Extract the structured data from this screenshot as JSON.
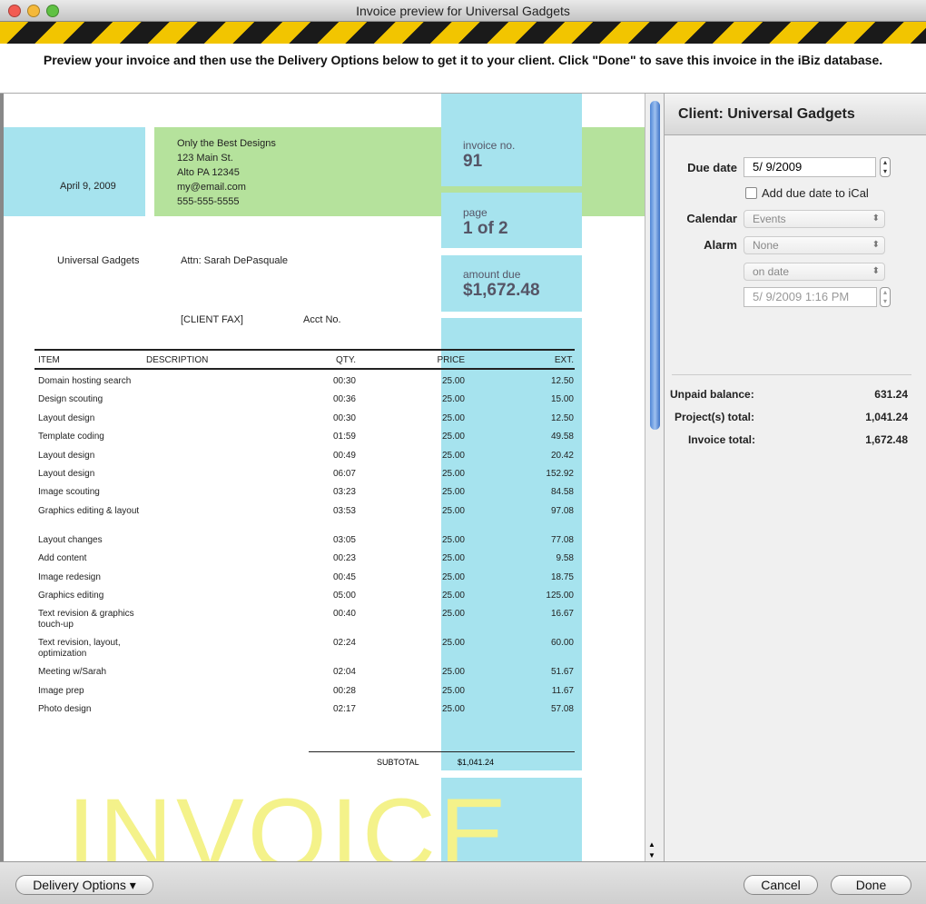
{
  "window": {
    "title": "Invoice preview for Universal Gadgets"
  },
  "instructions": "Preview your invoice and then use the Delivery Options below to get it to your client.  Click \"Done\" to save this invoice in the iBiz database.",
  "invoice": {
    "date": "April 9, 2009",
    "from": [
      "Only the Best Designs",
      "123 Main St.",
      "Alto PA 12345",
      "my@email.com",
      "555-555-5555"
    ],
    "invoice_no_label": "invoice no.",
    "invoice_no": "91",
    "page_label": "page",
    "page": "1 of 2",
    "amount_due_label": "amount due",
    "amount_due": "$1,672.48",
    "client": "Universal Gadgets",
    "attn": "Attn: Sarah DePasquale",
    "client_fax": "[CLIENT FAX]",
    "acct_no": "Acct No.",
    "headers": {
      "item": "ITEM",
      "description": "DESCRIPTION",
      "qty": "QTY.",
      "price": "PRICE",
      "ext": "EXT."
    },
    "rows": [
      {
        "item": "Domain hosting search",
        "qty": "00:30",
        "price": "25.00",
        "ext": "12.50"
      },
      {
        "item": "Design scouting",
        "qty": "00:36",
        "price": "25.00",
        "ext": "15.00"
      },
      {
        "item": "Layout design",
        "qty": "00:30",
        "price": "25.00",
        "ext": "12.50"
      },
      {
        "item": "Template coding",
        "qty": "01:59",
        "price": "25.00",
        "ext": "49.58"
      },
      {
        "item": "Layout design",
        "qty": "00:49",
        "price": "25.00",
        "ext": "20.42"
      },
      {
        "item": "Layout design",
        "qty": "06:07",
        "price": "25.00",
        "ext": "152.92"
      },
      {
        "item": "Image scouting",
        "qty": "03:23",
        "price": "25.00",
        "ext": "84.58"
      },
      {
        "item": "Graphics editing & layout",
        "qty": "03:53",
        "price": "25.00",
        "ext": "97.08"
      },
      {
        "item": "Layout changes",
        "qty": "03:05",
        "price": "25.00",
        "ext": "77.08"
      },
      {
        "item": "Add content",
        "qty": "00:23",
        "price": "25.00",
        "ext": "9.58"
      },
      {
        "item": "Image redesign",
        "qty": "00:45",
        "price": "25.00",
        "ext": "18.75"
      },
      {
        "item": "Graphics editing",
        "qty": "05:00",
        "price": "25.00",
        "ext": "125.00"
      },
      {
        "item": "Text revision & graphics touch-up",
        "qty": "00:40",
        "price": "25.00",
        "ext": "16.67"
      },
      {
        "item": "Text revision, layout, optimization",
        "qty": "02:24",
        "price": "25.00",
        "ext": "60.00"
      },
      {
        "item": "Meeting w/Sarah",
        "qty": "02:04",
        "price": "25.00",
        "ext": "51.67"
      },
      {
        "item": "Image prep",
        "qty": "00:28",
        "price": "25.00",
        "ext": "11.67"
      },
      {
        "item": "Photo design",
        "qty": "02:17",
        "price": "25.00",
        "ext": "57.08"
      }
    ],
    "subtotal_label": "SUBTOTAL",
    "subtotal": "$1,041.24",
    "watermark": "INVOICE"
  },
  "panel": {
    "title": "Client: Universal Gadgets",
    "due_date_label": "Due date",
    "due_date": "5/  9/2009",
    "ical_label": "Add due date to iCal",
    "calendar_label": "Calendar",
    "calendar": "Events",
    "alarm_label": "Alarm",
    "alarm": "None",
    "alarm_when": "on date",
    "alarm_datetime": "5/  9/2009   1:16 PM",
    "unpaid_label": "Unpaid balance:",
    "unpaid": "631.24",
    "projects_label": "Project(s) total:",
    "projects": "1,041.24",
    "invoice_total_label": "Invoice total:",
    "invoice_total": "1,672.48"
  },
  "buttons": {
    "delivery": "Delivery Options ▾",
    "cancel": "Cancel",
    "done": "Done"
  }
}
